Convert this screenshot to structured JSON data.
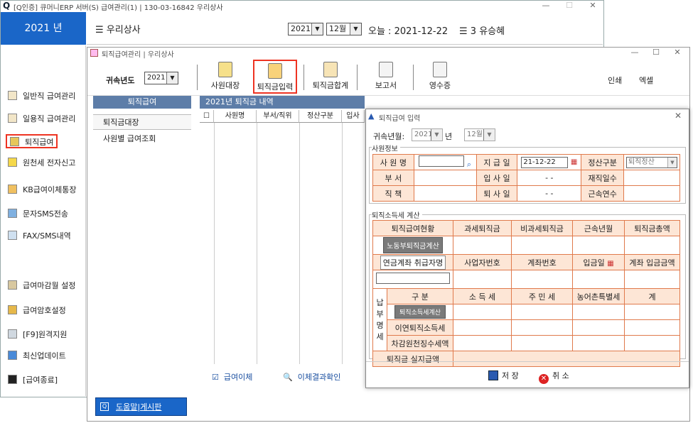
{
  "main": {
    "title": "[Q인증] 큐머니ERP 서버(S)  급여관리(1) | 130-03-16842  우리상사",
    "year_tile": "2021 년",
    "company": "우리상사",
    "year_value": "2021",
    "month_value": "12월",
    "today_label": "오늘 : 2021-12-22",
    "user_label": "3 유승혜",
    "help_link": "도움말|게시판"
  },
  "sidebar": {
    "items": [
      {
        "label": "일반직 급여관리"
      },
      {
        "label": "일용직 급여관리"
      },
      {
        "label": "퇴직급여"
      },
      {
        "label": "원천세 전자신고"
      },
      {
        "label": "KB급여이체통장"
      },
      {
        "label": "문자SMS전송"
      },
      {
        "label": "FAX/SMS내역"
      },
      {
        "label": "급여마감월 설정"
      },
      {
        "label": "급여암호설정"
      },
      {
        "label": "[F9]원격지원"
      },
      {
        "label": "최신업데이트"
      },
      {
        "label": "[급여종료]"
      }
    ]
  },
  "sub": {
    "title": "퇴직급여관리 | 우리상사",
    "year_label": "귀속년도",
    "year_value": "2021",
    "toolbar": [
      "사원대장",
      "퇴직금입력",
      "퇴직금합계",
      "보고서",
      "영수증"
    ],
    "print": "인쇄",
    "excel": "엑셀",
    "left_head": "퇴직급여",
    "left_items": [
      "퇴직금대장",
      "사원별 급여조회"
    ],
    "grid_head": "2021년 퇴직금 내역",
    "grid_cols": [
      "사원명",
      "부서/직위",
      "정산구분",
      "입사"
    ],
    "check_payroll": "급여이체",
    "check_result": "이체결과확인"
  },
  "dialog": {
    "title": "퇴직급여 입력",
    "period_label": "귀속년월:",
    "year": "2021",
    "year_suffix": "년",
    "month": "12월",
    "emp_group": "사원정보",
    "emp": {
      "name": "사 원 명",
      "pay_date": "지 급 일",
      "pay_date_val": "21-12-22",
      "settle_type": "정산구분",
      "settle_val": "퇴직정산",
      "dept": "부 서",
      "hire_date": "입 사 일",
      "hire_val": "- -",
      "days": "재직일수",
      "position": "직 책",
      "leave_date": "퇴 사 일",
      "leave_val": "- -",
      "years": "근속연수"
    },
    "tax_group": "퇴직소득세 계산",
    "tax": {
      "status": "퇴직급여현황",
      "taxable": "과세퇴직금",
      "nontaxable": "비과세퇴직금",
      "work_months": "근속년월",
      "total": "퇴직금총액",
      "labor_btn": "노동부퇴직금계산",
      "pension_btn": "연금계좌 취급자명",
      "biz_no": "사업자번호",
      "account": "계좌번호",
      "deposit_date": "입금일",
      "deposit_amt": "계좌 입금금액",
      "pay_tax_side": [
        "납",
        "부",
        "명",
        "세"
      ],
      "kind": "구 분",
      "income_tax": "소 득 세",
      "local_tax": "주 민 세",
      "rural_tax": "농어촌특별세",
      "sum": "계",
      "calc_btn": "퇴직소득세계산",
      "prev_tax": "이연퇴직소득세",
      "withhold": "차감원천징수세액",
      "net_pay": "퇴직금 실지급액"
    },
    "save": "저 장",
    "cancel": "취 소"
  }
}
